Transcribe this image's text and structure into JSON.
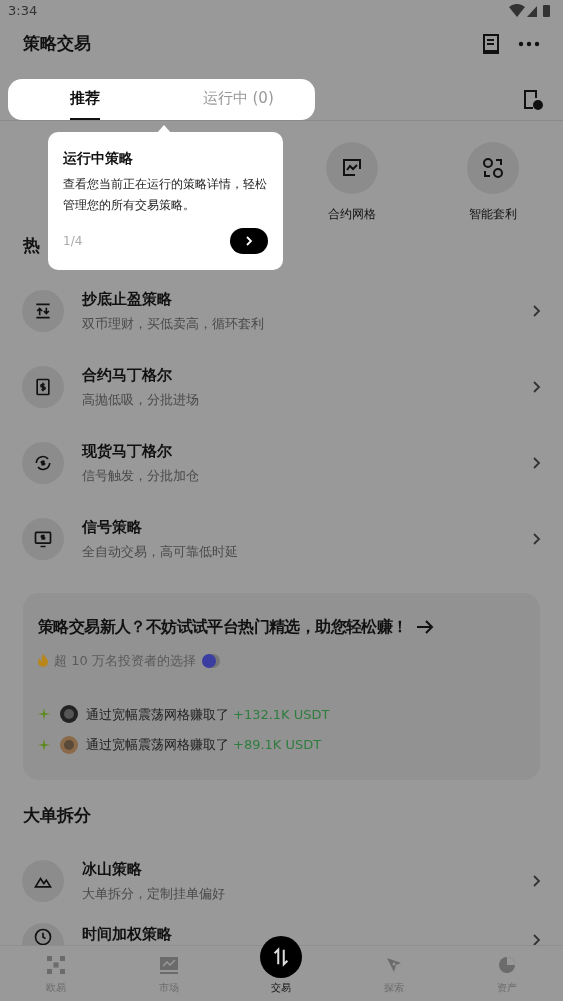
{
  "status_bar": {
    "time": "3:34"
  },
  "header": {
    "title": "策略交易"
  },
  "tabs": [
    {
      "label": "推荐",
      "selected": true
    },
    {
      "label": "运行中 (0)",
      "selected": false
    }
  ],
  "tooltip": {
    "title": "运行中策略",
    "body": "查看您当前正在运行的策略详情，轻松管理您的所有交易策略。",
    "step": "1/4"
  },
  "shortcuts": [
    {
      "label": "合约网格",
      "kind": "grid"
    },
    {
      "label": "智能套利",
      "kind": "arbitrage"
    }
  ],
  "hot_section": {
    "title": "热",
    "items": [
      {
        "title": "抄底止盈策略",
        "subtitle": "双币理财，买低卖高，循环套利",
        "kind": "swap"
      },
      {
        "title": "合约马丁格尔",
        "subtitle": "高抛低吸，分批进场",
        "kind": "dollar"
      },
      {
        "title": "现货马丁格尔",
        "subtitle": "信号触发，分批加仓",
        "kind": "cycle"
      },
      {
        "title": "信号策略",
        "subtitle": "全自动交易，高可靠低时延",
        "kind": "signal"
      }
    ]
  },
  "promo": {
    "title": "策略交易新人？不妨试试平台热门精选，助您轻松赚！",
    "note": "超 10 万名投资者的选择",
    "earnings": [
      {
        "text": "通过宽幅震荡网格赚取了",
        "amount": "+132.1K USDT"
      },
      {
        "text": "通过宽幅震荡网格赚取了",
        "amount": "+89.1K USDT"
      }
    ]
  },
  "split_section": {
    "title": "大单拆分",
    "items": [
      {
        "title": "冰山策略",
        "subtitle": "大单拆分，定制挂单偏好",
        "kind": "mountain"
      },
      {
        "title": "时间加权策略",
        "kind": "clock"
      }
    ]
  },
  "bottom_nav": [
    {
      "label": "欧易",
      "selected": false,
      "kind": "home"
    },
    {
      "label": "市场",
      "selected": false,
      "kind": "market"
    },
    {
      "label": "交易",
      "selected": true,
      "kind": "trade"
    },
    {
      "label": "探索",
      "selected": false,
      "kind": "explore"
    },
    {
      "label": "资产",
      "selected": false,
      "kind": "assets"
    }
  ]
}
